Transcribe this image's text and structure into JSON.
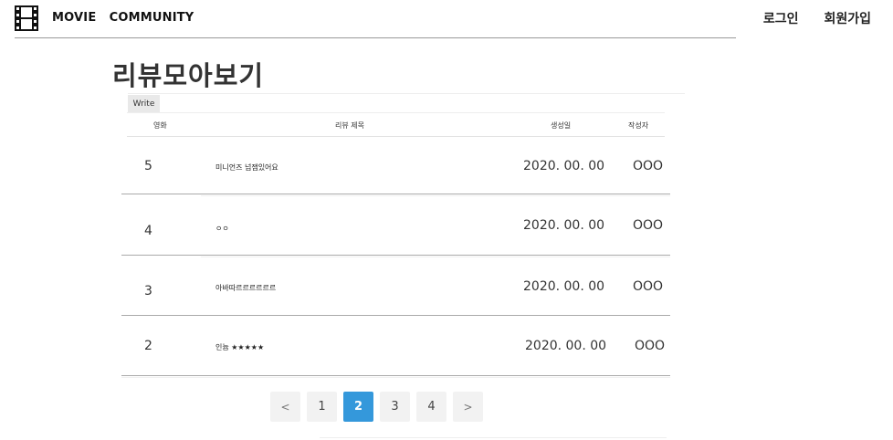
{
  "header": {
    "brand": "MOVIE   COMMUNITY",
    "login": "로그인",
    "signup": "회원가입"
  },
  "page_title": "리뷰모아보기",
  "write_button": "Write",
  "table": {
    "columns": [
      "영화",
      "리뷰 제목",
      "생성일",
      "작성자"
    ],
    "rows": [
      {
        "num": "5",
        "title": "미니언즈 넘잼있어요",
        "date": "2020. 00. 00",
        "author": "OOO"
      },
      {
        "num": "4",
        "title": "ㅇㅇ",
        "date": "2020. 00. 00",
        "author": "OOO"
      },
      {
        "num": "3",
        "title": "아바따르르르르르르",
        "date": "2020. 00. 00",
        "author": "OOO"
      },
      {
        "num": "2",
        "title": "인늄 ★★★★★",
        "date": "2020. 00. 00",
        "author": "OOO"
      }
    ]
  },
  "pagination": {
    "prev": "<",
    "pages": [
      "1",
      "2",
      "3",
      "4"
    ],
    "active_page": "2",
    "next": ">"
  },
  "colors": {
    "accent": "#3498db",
    "header_line": "#9a9a9a",
    "row_line": "#aaaaaa"
  }
}
